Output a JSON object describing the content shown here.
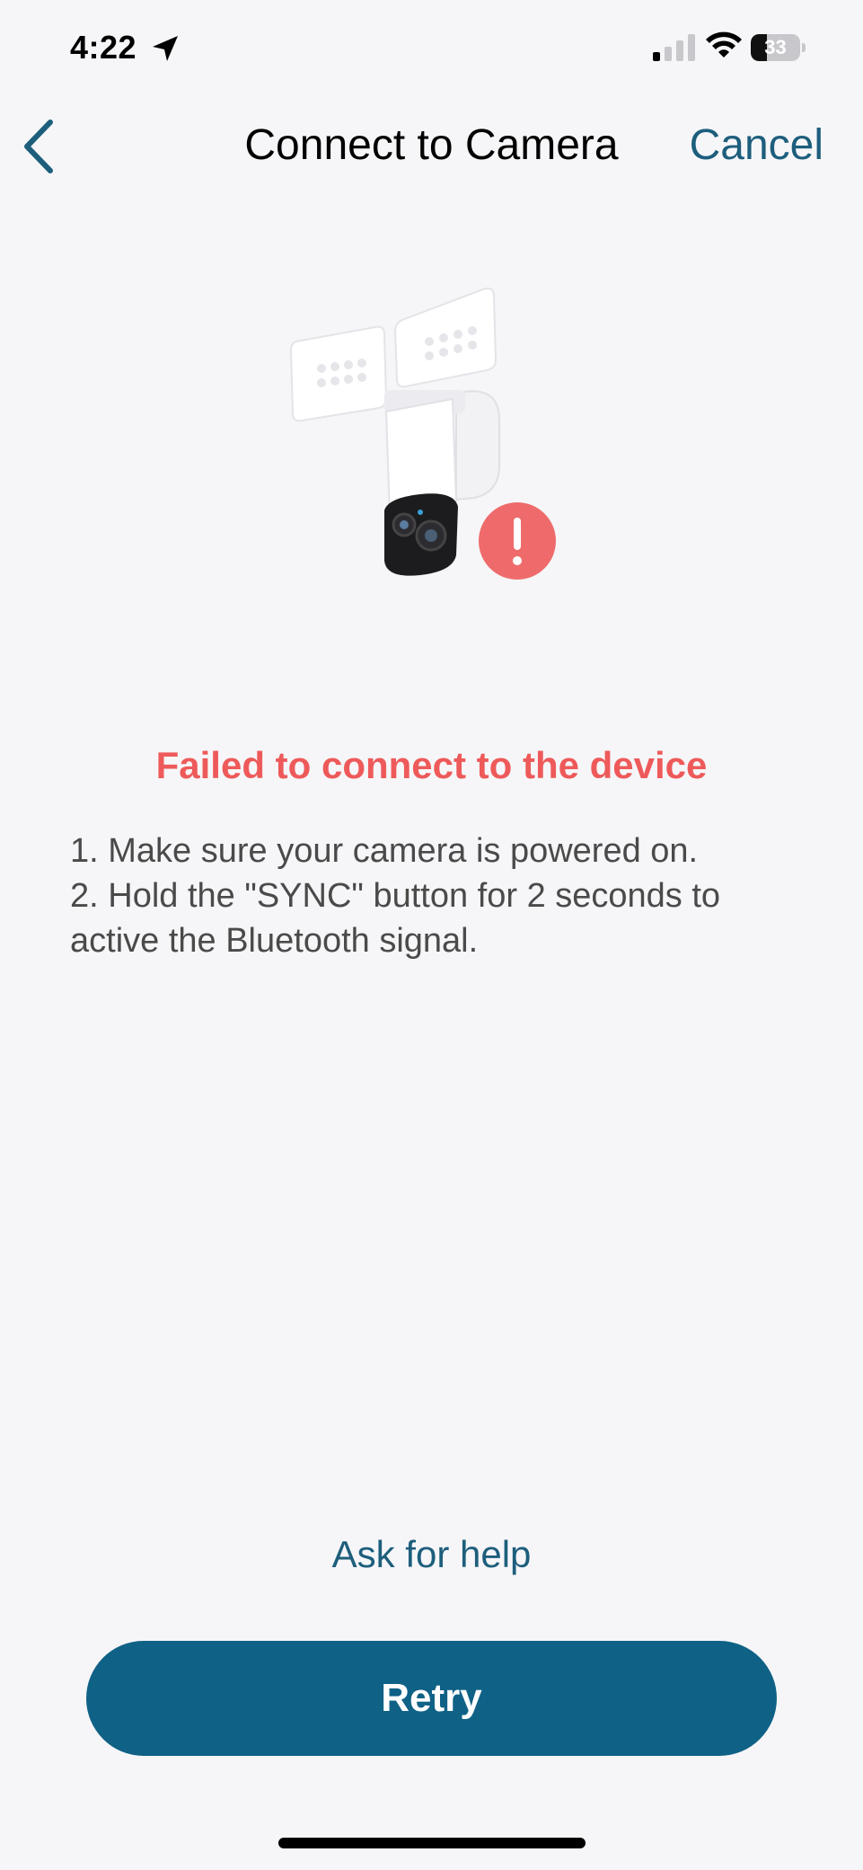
{
  "status_bar": {
    "time": "4:22",
    "battery_level": "33",
    "battery_fraction": 0.33,
    "icons": [
      "location-arrow-icon",
      "cellular-signal-icon",
      "wifi-icon",
      "battery-icon"
    ]
  },
  "nav": {
    "back_icon": "chevron-left-icon",
    "title": "Connect to Camera",
    "cancel_label": "Cancel"
  },
  "illustration": {
    "subject": "floodlight-camera",
    "badge_icon": "exclamation-icon",
    "badge_color": "#ef6b6b"
  },
  "message": {
    "title": "Failed to connect to the device",
    "steps": [
      "1. Make sure your camera is powered on.",
      "2. Hold the \"SYNC\" button for 2 seconds to active the Bluetooth signal."
    ]
  },
  "actions": {
    "help_label": "Ask for help",
    "retry_label": "Retry"
  },
  "colors": {
    "accent": "#0f6186",
    "link": "#1d5e7c",
    "error": "#ee5a5a",
    "background": "#f6f6f8"
  }
}
